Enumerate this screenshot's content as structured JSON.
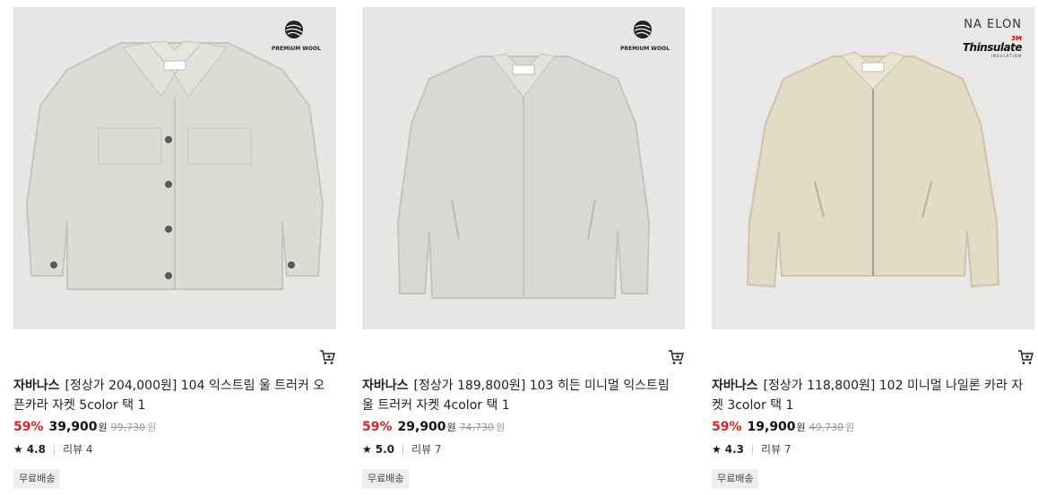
{
  "products": [
    {
      "badge": "PREMIUM WOOL",
      "brand": "자바나스",
      "title": "[정상가 204,000원] 104 익스트림 울 트러커 오픈카라 자켓 5color 택 1",
      "discount": "59%",
      "price": "39,900",
      "price_unit": "원",
      "original_price": "99,730",
      "original_unit": "원",
      "rating": "4.8",
      "review": "리뷰 4",
      "shipping": "무료배송",
      "jacket_color": "#dcdcd5"
    },
    {
      "badge": "PREMIUM WOOL",
      "brand": "자바나스",
      "title": "[정상가 189,800원] 103 히든 미니멀 익스트림 울 트러커 자켓 4color 택 1",
      "discount": "59%",
      "price": "29,900",
      "price_unit": "원",
      "original_price": "74,730",
      "original_unit": "원",
      "rating": "5.0",
      "review": "리뷰 7",
      "shipping": "무료배송",
      "jacket_color": "#d9d9d3"
    },
    {
      "badge_top": "NA ELON",
      "badge_3m": "3M",
      "badge_brand": "Thinsulate",
      "badge_sub": "INSULATION",
      "brand": "자바나스",
      "title": "[정상가 118,800원] 102 미니멀 나일론 카라 자켓 3color 택 1",
      "discount": "59%",
      "price": "19,900",
      "price_unit": "원",
      "original_price": "49,730",
      "original_unit": "원",
      "rating": "4.3",
      "review": "리뷰 7",
      "shipping": "무료배송",
      "jacket_color": "#e2dcc6"
    }
  ],
  "icons": {
    "cart": "cart-icon",
    "star": "star-icon",
    "wool": "yarn-ball-icon"
  }
}
